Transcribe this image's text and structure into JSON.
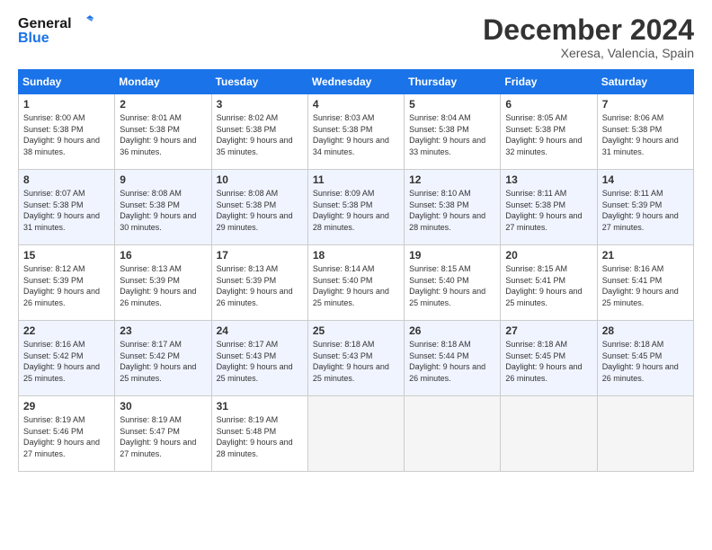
{
  "header": {
    "logo_line1": "General",
    "logo_line2": "Blue",
    "title": "December 2024",
    "location": "Xeresa, Valencia, Spain"
  },
  "days_of_week": [
    "Sunday",
    "Monday",
    "Tuesday",
    "Wednesday",
    "Thursday",
    "Friday",
    "Saturday"
  ],
  "weeks": [
    [
      {
        "day": "1",
        "sunrise": "8:00 AM",
        "sunset": "5:38 PM",
        "daylight": "9 hours and 38 minutes."
      },
      {
        "day": "2",
        "sunrise": "8:01 AM",
        "sunset": "5:38 PM",
        "daylight": "9 hours and 36 minutes."
      },
      {
        "day": "3",
        "sunrise": "8:02 AM",
        "sunset": "5:38 PM",
        "daylight": "9 hours and 35 minutes."
      },
      {
        "day": "4",
        "sunrise": "8:03 AM",
        "sunset": "5:38 PM",
        "daylight": "9 hours and 34 minutes."
      },
      {
        "day": "5",
        "sunrise": "8:04 AM",
        "sunset": "5:38 PM",
        "daylight": "9 hours and 33 minutes."
      },
      {
        "day": "6",
        "sunrise": "8:05 AM",
        "sunset": "5:38 PM",
        "daylight": "9 hours and 32 minutes."
      },
      {
        "day": "7",
        "sunrise": "8:06 AM",
        "sunset": "5:38 PM",
        "daylight": "9 hours and 31 minutes."
      }
    ],
    [
      {
        "day": "8",
        "sunrise": "8:07 AM",
        "sunset": "5:38 PM",
        "daylight": "9 hours and 31 minutes."
      },
      {
        "day": "9",
        "sunrise": "8:08 AM",
        "sunset": "5:38 PM",
        "daylight": "9 hours and 30 minutes."
      },
      {
        "day": "10",
        "sunrise": "8:08 AM",
        "sunset": "5:38 PM",
        "daylight": "9 hours and 29 minutes."
      },
      {
        "day": "11",
        "sunrise": "8:09 AM",
        "sunset": "5:38 PM",
        "daylight": "9 hours and 28 minutes."
      },
      {
        "day": "12",
        "sunrise": "8:10 AM",
        "sunset": "5:38 PM",
        "daylight": "9 hours and 28 minutes."
      },
      {
        "day": "13",
        "sunrise": "8:11 AM",
        "sunset": "5:38 PM",
        "daylight": "9 hours and 27 minutes."
      },
      {
        "day": "14",
        "sunrise": "8:11 AM",
        "sunset": "5:39 PM",
        "daylight": "9 hours and 27 minutes."
      }
    ],
    [
      {
        "day": "15",
        "sunrise": "8:12 AM",
        "sunset": "5:39 PM",
        "daylight": "9 hours and 26 minutes."
      },
      {
        "day": "16",
        "sunrise": "8:13 AM",
        "sunset": "5:39 PM",
        "daylight": "9 hours and 26 minutes."
      },
      {
        "day": "17",
        "sunrise": "8:13 AM",
        "sunset": "5:39 PM",
        "daylight": "9 hours and 26 minutes."
      },
      {
        "day": "18",
        "sunrise": "8:14 AM",
        "sunset": "5:40 PM",
        "daylight": "9 hours and 25 minutes."
      },
      {
        "day": "19",
        "sunrise": "8:15 AM",
        "sunset": "5:40 PM",
        "daylight": "9 hours and 25 minutes."
      },
      {
        "day": "20",
        "sunrise": "8:15 AM",
        "sunset": "5:41 PM",
        "daylight": "9 hours and 25 minutes."
      },
      {
        "day": "21",
        "sunrise": "8:16 AM",
        "sunset": "5:41 PM",
        "daylight": "9 hours and 25 minutes."
      }
    ],
    [
      {
        "day": "22",
        "sunrise": "8:16 AM",
        "sunset": "5:42 PM",
        "daylight": "9 hours and 25 minutes."
      },
      {
        "day": "23",
        "sunrise": "8:17 AM",
        "sunset": "5:42 PM",
        "daylight": "9 hours and 25 minutes."
      },
      {
        "day": "24",
        "sunrise": "8:17 AM",
        "sunset": "5:43 PM",
        "daylight": "9 hours and 25 minutes."
      },
      {
        "day": "25",
        "sunrise": "8:18 AM",
        "sunset": "5:43 PM",
        "daylight": "9 hours and 25 minutes."
      },
      {
        "day": "26",
        "sunrise": "8:18 AM",
        "sunset": "5:44 PM",
        "daylight": "9 hours and 26 minutes."
      },
      {
        "day": "27",
        "sunrise": "8:18 AM",
        "sunset": "5:45 PM",
        "daylight": "9 hours and 26 minutes."
      },
      {
        "day": "28",
        "sunrise": "8:18 AM",
        "sunset": "5:45 PM",
        "daylight": "9 hours and 26 minutes."
      }
    ],
    [
      {
        "day": "29",
        "sunrise": "8:19 AM",
        "sunset": "5:46 PM",
        "daylight": "9 hours and 27 minutes."
      },
      {
        "day": "30",
        "sunrise": "8:19 AM",
        "sunset": "5:47 PM",
        "daylight": "9 hours and 27 minutes."
      },
      {
        "day": "31",
        "sunrise": "8:19 AM",
        "sunset": "5:48 PM",
        "daylight": "9 hours and 28 minutes."
      },
      null,
      null,
      null,
      null
    ]
  ]
}
